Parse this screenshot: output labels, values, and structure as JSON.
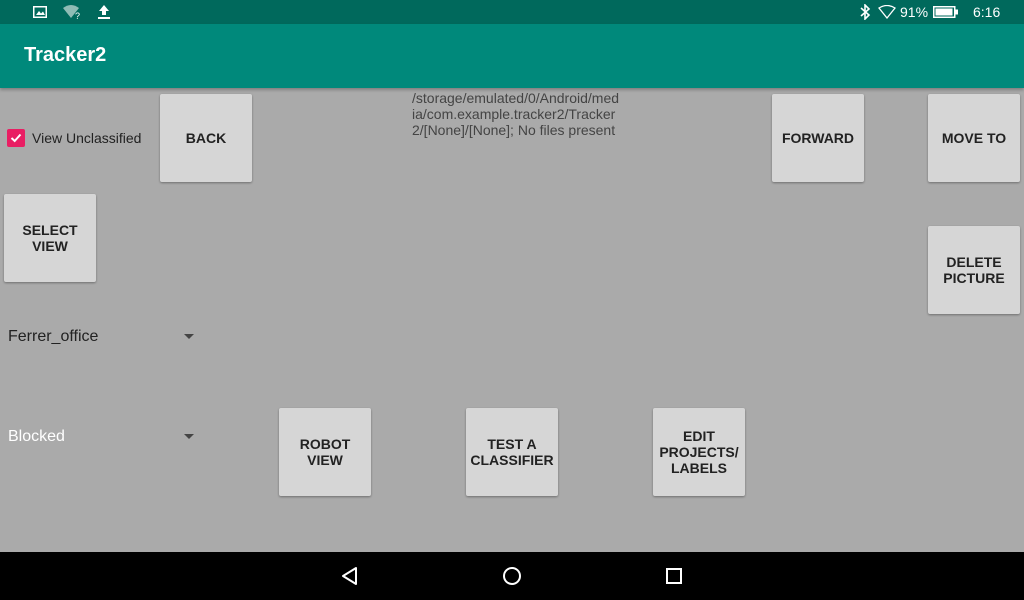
{
  "status_bar": {
    "battery_percent": "91%",
    "time": "6:16",
    "icons": [
      "image-icon",
      "wifi-question-icon",
      "upload-icon",
      "bluetooth-icon",
      "wifi-signal-icon",
      "battery-icon"
    ]
  },
  "app_bar": {
    "title": "Tracker2",
    "color": "#00897b"
  },
  "main": {
    "checkbox": {
      "label": "View Unclassified",
      "checked": true,
      "color": "#e91e63"
    },
    "buttons": {
      "back": "BACK",
      "forward": "FORWARD",
      "move_to": "MOVE TO",
      "select_view": "SELECT\nVIEW",
      "delete_picture": "DELETE\nPICTURE",
      "robot_view": "ROBOT\nVIEW",
      "test_classifier": "TEST A\nCLASSIFIER",
      "edit_projects": "EDIT\nPROJECTS/\nLABELS"
    },
    "path_text": "/storage/emulated/0/Android/media/com.example.tracker2/Tracker2/[None]/[None]; No files present",
    "spinners": {
      "location": "Ferrer_office",
      "label": "Blocked"
    }
  },
  "nav_bar": {
    "icons": [
      "back-triangle-icon",
      "home-circle-icon",
      "recents-square-icon"
    ]
  }
}
